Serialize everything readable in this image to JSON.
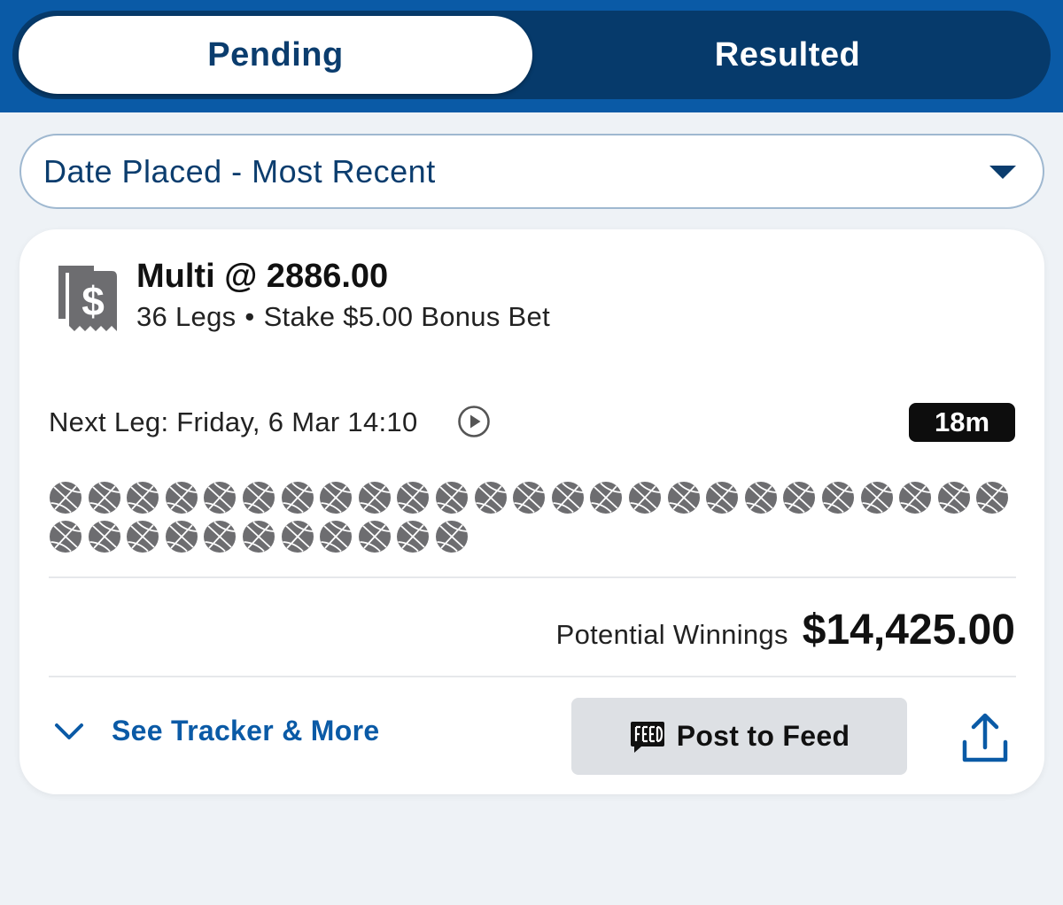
{
  "tabs": [
    {
      "label": "Pending",
      "active": true
    },
    {
      "label": "Resulted",
      "active": false
    }
  ],
  "sort": {
    "label": "Date Placed - Most Recent"
  },
  "bet": {
    "title": "Multi @ 2886.00",
    "legs_text": "36 Legs",
    "separator": "•",
    "stake_text": "Stake $5.00 Bonus Bet",
    "next_leg": "Next Leg: Friday, 6 Mar 14:10",
    "timer": "18m",
    "leg_count": 36,
    "leg_icon": "basketball-icon",
    "potential_label": "Potential Winnings",
    "potential_value": "$14,425.00",
    "tracker_label": "See Tracker & More",
    "post_label": "Post to Feed"
  },
  "colors": {
    "header_blue": "#0a5aa6",
    "segment_navy": "#063a6b",
    "text_navy": "#0b3d6e",
    "link_blue": "#0a5aa6",
    "ball_gray": "#6d6d70"
  }
}
